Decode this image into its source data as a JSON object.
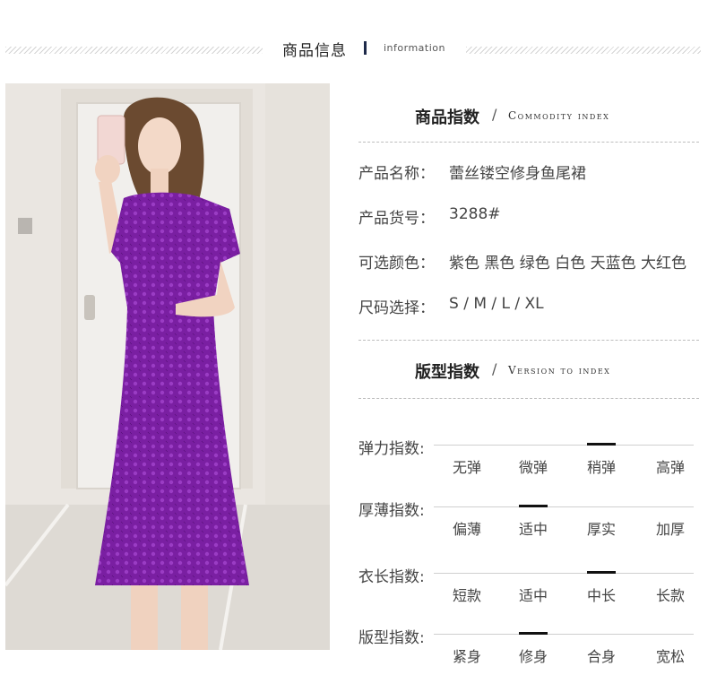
{
  "header": {
    "title": "商品信息",
    "subtitle": "information"
  },
  "commodity_section": {
    "title": "商品指数",
    "slash": "/",
    "en": "Commodity index"
  },
  "product": {
    "name_label": "产品名称：",
    "name_value": "蕾丝镂空修身鱼尾裙",
    "code_label": "产品货号：",
    "code_value": "3288#",
    "colors_label": "可选颜色：",
    "colors_value": "紫色 黑色 绿色 白色 天蓝色 大红色",
    "sizes_label": "尺码选择：",
    "sizes_value": "S / M / L / XL"
  },
  "version_section": {
    "title": "版型指数",
    "slash": "/",
    "en": "Version to index"
  },
  "indices": [
    {
      "label": "弹力指数:",
      "options": [
        "无弹",
        "微弹",
        "稍弹",
        "高弹"
      ],
      "selected_index": 2
    },
    {
      "label": "厚薄指数:",
      "options": [
        "偏薄",
        "适中",
        "厚实",
        "加厚"
      ],
      "selected_index": 1
    },
    {
      "label": "衣长指数:",
      "options": [
        "短款",
        "适中",
        "中长",
        "长款"
      ],
      "selected_index": 2
    },
    {
      "label": "版型指数:",
      "options": [
        "紧身",
        "修身",
        "合身",
        "宽松"
      ],
      "selected_index": 1
    }
  ],
  "colors": {
    "dress": "#7a1fa2",
    "marker": "#111111"
  }
}
